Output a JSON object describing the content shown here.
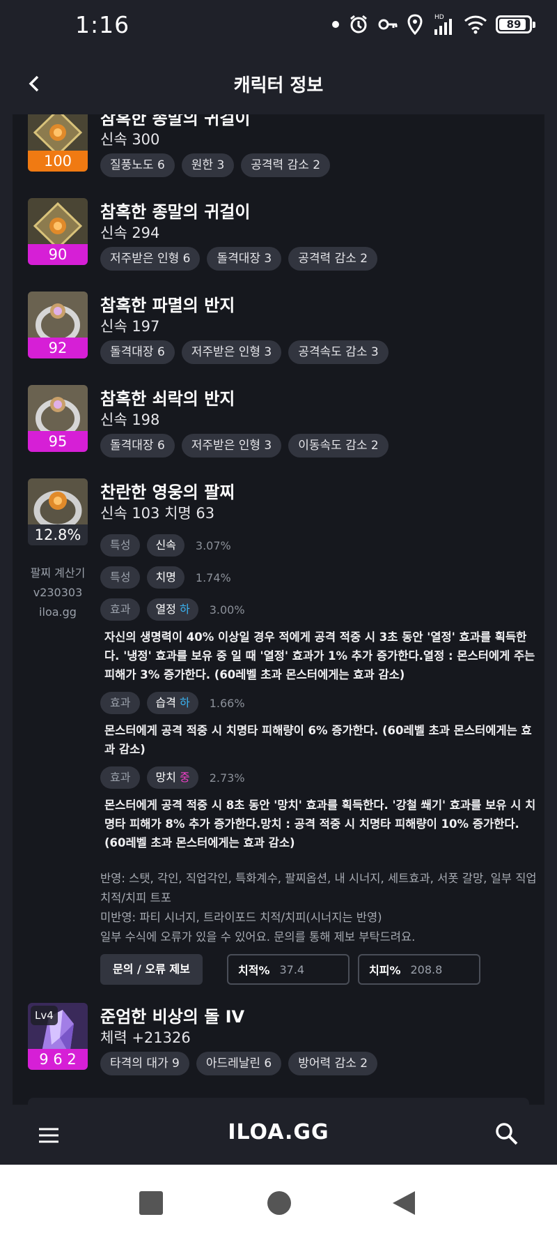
{
  "status": {
    "time": "1:16",
    "battery": "89"
  },
  "header": {
    "title": "캐릭터 정보"
  },
  "accessories": [
    {
      "name": "참혹한 종말의 귀걸이",
      "stat": "신속 300",
      "quality": "100",
      "quality_color": "#f07a12",
      "engravings": [
        "질풍노도 6",
        "원한 3",
        "공격력 감소 2"
      ]
    },
    {
      "name": "참혹한 종말의 귀걸이",
      "stat": "신속 294",
      "quality": "90",
      "quality_color": "#d61fd6",
      "engravings": [
        "저주받은 인형 6",
        "돌격대장 3",
        "공격력 감소 2"
      ]
    },
    {
      "name": "참혹한 파멸의 반지",
      "stat": "신속 197",
      "quality": "92",
      "quality_color": "#d61fd6",
      "engravings": [
        "돌격대장 6",
        "저주받은 인형 3",
        "공격속도 감소 3"
      ]
    },
    {
      "name": "참혹한 쇠락의 반지",
      "stat": "신속 198",
      "quality": "95",
      "quality_color": "#d61fd6",
      "engravings": [
        "돌격대장 6",
        "저주받은 인형 3",
        "이동속도 감소 2"
      ]
    }
  ],
  "bracelet": {
    "name": "찬란한 영웅의 팔찌",
    "stat": "신속 103  치명 63",
    "percent": "12.8%",
    "calc_label": [
      "팔찌 계산기",
      "v230303",
      "iloa.gg"
    ],
    "rows": [
      {
        "type": "특성",
        "name": "신속",
        "grade": "",
        "pct": "3.07%"
      },
      {
        "type": "특성",
        "name": "치명",
        "grade": "",
        "pct": "1.74%"
      },
      {
        "type": "효과",
        "name": "열정",
        "grade": "하",
        "pct": "3.00%",
        "desc": "자신의 생명력이 40% 이상일 경우 적에게 공격 적중 시 3초 동안 '열정' 효과를 획득한다. '냉정' 효과를 보유 중 일 때 '열정' 효과가 1% 추가 증가한다.열정 : 몬스터에게 주는 피해가 3% 증가한다. (60레벨 초과 몬스터에게는 효과 감소)"
      },
      {
        "type": "효과",
        "name": "습격",
        "grade": "하",
        "pct": "1.66%",
        "desc": "몬스터에게 공격 적중 시 치명타 피해량이 6% 증가한다. (60레벨 초과 몬스터에게는 효과 감소)"
      },
      {
        "type": "효과",
        "name": "망치",
        "grade": "중",
        "pct": "2.73%",
        "desc": "몬스터에게 공격 적중 시 8초 동안 '망치' 효과를 획득한다. '강철 쐐기' 효과를 보유 시 치명타 피해가 8% 추가 증가한다.망치 : 공격 적중 시 치명타 피해량이 10% 증가한다. (60레벨 초과 몬스터에게는 효과 감소)"
      }
    ],
    "note_lines": [
      "반영: 스탯, 각인, 직업각인, 특화계수, 팔찌옵션, 내 시너지, 세트효과, 서폿 갈망, 일부 직업 치적/치피 트포",
      "미반영: 파티 시너지, 트라이포드 치적/치피(시너지는 반영)",
      "일부 수식에 오류가 있을 수 있어요. 문의를 통해 제보 부탁드려요."
    ],
    "report_button": "문의 / 오류 제보",
    "crit_rate_label": "치적%",
    "crit_rate_value": "37.4",
    "crit_dmg_label": "치피%",
    "crit_dmg_value": "208.8"
  },
  "stone": {
    "name": "준엄한 비상의 돌 IV",
    "stat": "체력 +21326",
    "level": "Lv4",
    "quality": "9 6 2",
    "engravings": [
      "타격의 대가 9",
      "아드레날린 6",
      "방어력 감소 2"
    ]
  },
  "bottom_nav": {
    "brand": "ILOA.GG"
  }
}
